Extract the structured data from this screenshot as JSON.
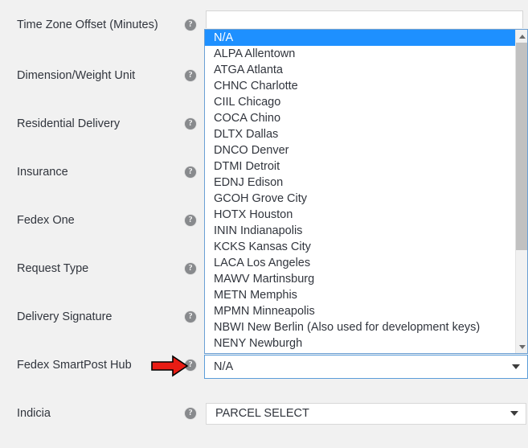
{
  "theme": {
    "page_background": "#f1f1f1",
    "highlight_blue": "#1e90ff",
    "focus_border": "#5b9dd9",
    "text_color": "#31353d",
    "arrow_red": "#e81c14",
    "scrollbar_thumb": "#c1c1c1"
  },
  "form": {
    "labels": [
      {
        "text": "Time Zone Offset (Minutes)",
        "help": "?"
      },
      {
        "text": "Dimension/Weight Unit",
        "help": "?"
      },
      {
        "text": "Residential Delivery",
        "help": "?"
      },
      {
        "text": "Insurance",
        "help": "?"
      },
      {
        "text": "Fedex One",
        "help": "?"
      },
      {
        "text": "Request Type",
        "help": "?"
      },
      {
        "text": "Delivery Signature",
        "help": "?"
      },
      {
        "text": "Fedex SmartPost Hub",
        "help": "?"
      },
      {
        "text": "Indicia",
        "help": "?"
      }
    ]
  },
  "combo_input": {
    "value": "",
    "placeholder": ""
  },
  "dropdown": {
    "open": true,
    "selected_index": 0,
    "options": [
      "N/A",
      "ALPA Allentown",
      "ATGA Atlanta",
      "CHNC Charlotte",
      "CIIL Chicago",
      "COCA Chino",
      "DLTX Dallas",
      "DNCO Denver",
      "DTMI Detroit",
      "EDNJ Edison",
      "GCOH Grove City",
      "HOTX Houston",
      "ININ Indianapolis",
      "KCKS Kansas City",
      "LACA Los Angeles",
      "MAWV Martinsburg",
      "METN Memphis",
      "MPMN Minneapolis",
      "NBWI New Berlin (Also used for development keys)",
      "NENY Newburgh"
    ],
    "scrollbar": {
      "up_arrow": "scroll-up",
      "down_arrow": "scroll-down"
    }
  },
  "smartpost_hub_select": {
    "value": "N/A",
    "caret": "chevron-down"
  },
  "indicia_select": {
    "value": "PARCEL SELECT",
    "caret": "chevron-down"
  },
  "annotation": {
    "arrow": "red-right-arrow",
    "points_to": "Fedex SmartPost Hub"
  }
}
